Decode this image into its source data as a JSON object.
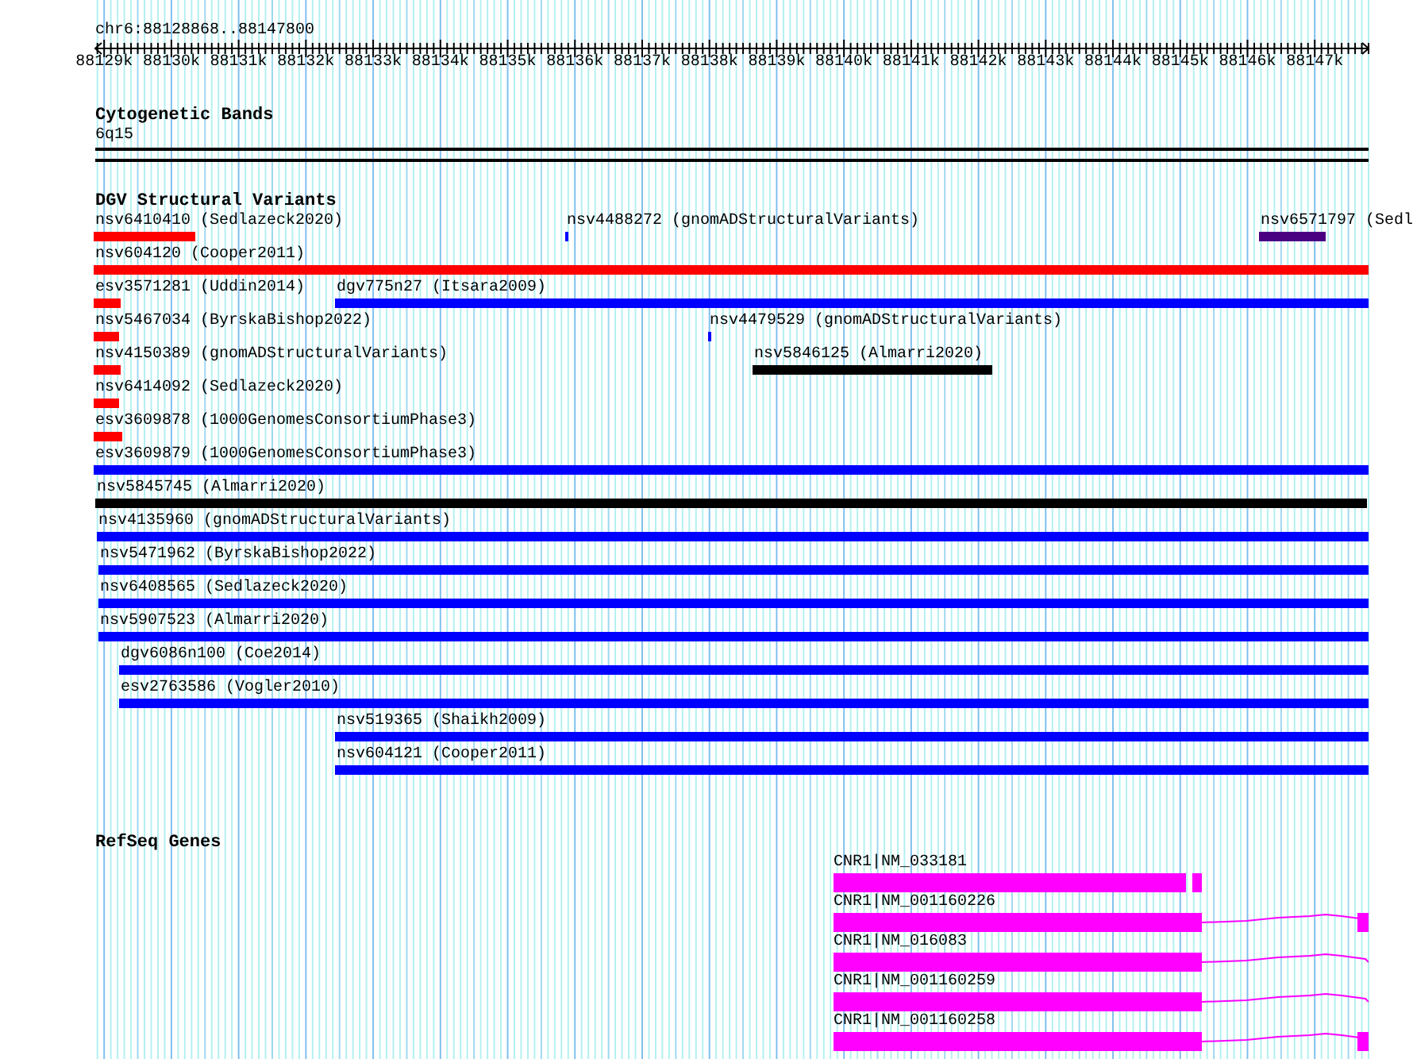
{
  "location": "chr6:88128868..88147800",
  "ruler": {
    "ticks": [
      "88129k",
      "88130k",
      "88131k",
      "88132k",
      "88133k",
      "88134k",
      "88135k",
      "88136k",
      "88137k",
      "88138k",
      "88139k",
      "88140k",
      "88141k",
      "88142k",
      "88143k",
      "88144k",
      "88145k",
      "88146k",
      "88147k"
    ]
  },
  "tracks": [
    {
      "kind": "bands",
      "title": "Cytogenetic Bands",
      "bands": [
        {
          "label": "6q15"
        }
      ]
    },
    {
      "kind": "variants",
      "title": "DGV Structural Variants",
      "features": [
        {
          "label": "nsv6410410 (Sedlazeck2020)",
          "color": "#ff0000"
        },
        {
          "label": "nsv4488272 (gnomADStructuralVariants)",
          "color": "#0000ff"
        },
        {
          "label": "nsv6571797 (Sedl",
          "color": "#4b0082"
        },
        {
          "label": "nsv604120 (Cooper2011)",
          "color": "#ff0000"
        },
        {
          "label": "esv3571281 (Uddin2014)",
          "color": "#ff0000"
        },
        {
          "label": "dgv775n27 (Itsara2009)",
          "color": "#0000ff"
        },
        {
          "label": "nsv5467034 (ByrskaBishop2022)",
          "color": "#ff0000"
        },
        {
          "label": "nsv4479529 (gnomADStructuralVariants)",
          "color": "#0000ff"
        },
        {
          "label": "nsv4150389 (gnomADStructuralVariants)",
          "color": "#ff0000"
        },
        {
          "label": "nsv5846125 (Almarri2020)",
          "color": "#000000"
        },
        {
          "label": "nsv6414092 (Sedlazeck2020)",
          "color": "#ff0000"
        },
        {
          "label": "esv3609878 (1000GenomesConsortiumPhase3)",
          "color": "#ff0000"
        },
        {
          "label": "esv3609879 (1000GenomesConsortiumPhase3)",
          "color": "#0000ff"
        },
        {
          "label": "nsv5845745 (Almarri2020)",
          "color": "#000000"
        },
        {
          "label": "nsv4135960 (gnomADStructuralVariants)",
          "color": "#0000ff"
        },
        {
          "label": "nsv5471962 (ByrskaBishop2022)",
          "color": "#0000ff"
        },
        {
          "label": "nsv6408565 (Sedlazeck2020)",
          "color": "#0000ff"
        },
        {
          "label": "nsv5907523 (Almarri2020)",
          "color": "#0000ff"
        },
        {
          "label": "dgv6086n100 (Coe2014)",
          "color": "#0000ff"
        },
        {
          "label": "esv2763586 (Vogler2010)",
          "color": "#0000ff"
        },
        {
          "label": "nsv519365 (Shaikh2009)",
          "color": "#0000ff"
        },
        {
          "label": "nsv604121 (Cooper2011)",
          "color": "#0000ff"
        }
      ]
    },
    {
      "kind": "genes",
      "title": "RefSeq Genes",
      "transcripts": [
        {
          "label": "CNR1|NM_033181"
        },
        {
          "label": "CNR1|NM_001160226"
        },
        {
          "label": "CNR1|NM_016083"
        },
        {
          "label": "CNR1|NM_001160259"
        },
        {
          "label": "CNR1|NM_001160258"
        }
      ]
    }
  ]
}
